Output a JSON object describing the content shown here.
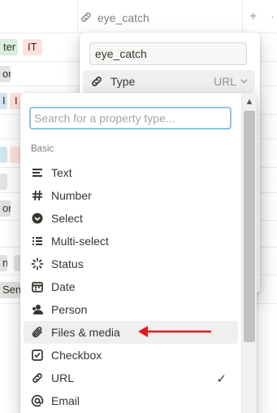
{
  "column_header": {
    "icon": "link-icon",
    "label": "eye_catch",
    "add": "+"
  },
  "bg_tags": [
    "ter",
    "IT",
    "or",
    "I",
    "I",
    "or",
    "n",
    "Seni"
  ],
  "colors": {
    "accent": "#8ec4e0",
    "arrow": "#e01b1b",
    "hover": "#ebebea"
  },
  "property_panel": {
    "name_value": "eye_catch",
    "type_label": "Type",
    "type_value": "URL"
  },
  "type_menu": {
    "search_placeholder": "Search for a property type...",
    "section": "Basic",
    "items": [
      {
        "label": "Text",
        "icon": "text-lines-icon"
      },
      {
        "label": "Number",
        "icon": "hash-icon"
      },
      {
        "label": "Select",
        "icon": "select-chevron-icon"
      },
      {
        "label": "Multi-select",
        "icon": "list-icon"
      },
      {
        "label": "Status",
        "icon": "status-spinner-icon"
      },
      {
        "label": "Date",
        "icon": "calendar-icon"
      },
      {
        "label": "Person",
        "icon": "person-icon"
      },
      {
        "label": "Files & media",
        "icon": "paperclip-icon"
      },
      {
        "label": "Checkbox",
        "icon": "checkbox-icon"
      },
      {
        "label": "URL",
        "icon": "link-icon",
        "check": "✓"
      },
      {
        "label": "Email",
        "icon": "at-icon"
      }
    ]
  }
}
